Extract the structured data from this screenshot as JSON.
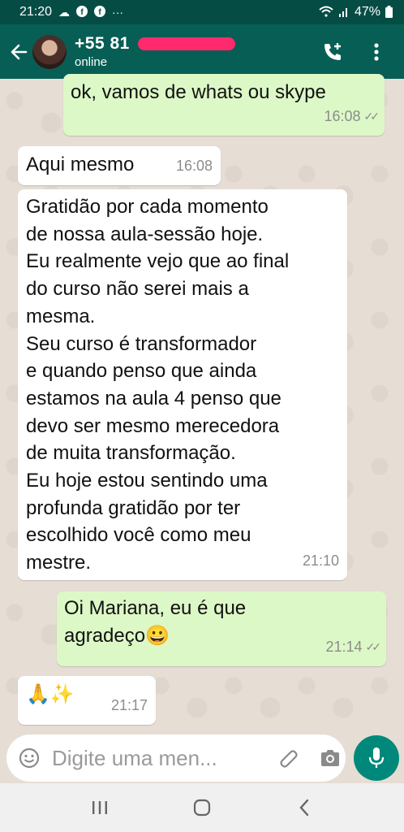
{
  "status_bar": {
    "time": "21:20",
    "notification_icons": [
      "cloud-icon",
      "facebook-icon",
      "facebook-icon",
      "more-dots-icon"
    ],
    "battery": "47%"
  },
  "header": {
    "contact_name": "+55 81",
    "status": "online"
  },
  "messages": [
    {
      "direction": "out",
      "text": "ok, vamos de whats ou skype",
      "time": "16:08",
      "read": true
    },
    {
      "direction": "in",
      "text": "Aqui mesmo",
      "time": "16:08"
    },
    {
      "direction": "in",
      "text": "Gratidão por cada momento\nde nossa aula-sessão hoje.\nEu realmente vejo que ao final\ndo curso não serei mais a\nmesma.\nSeu curso é transformador\ne quando penso que ainda\nestamos na aula 4 penso que\ndevo ser mesmo merecedora\nde muita transformação.\nEu hoje estou sentindo uma\nprofunda gratidão por ter\nescolhido você como meu\nmestre.",
      "time": "21:10"
    },
    {
      "direction": "out",
      "text": "Oi Mariana, eu é que\nagradeço😀",
      "time": "21:14",
      "read": true
    },
    {
      "direction": "in",
      "text": "🙏✨",
      "time": "21:17"
    }
  ],
  "composer": {
    "placeholder": "Digite uma men..."
  },
  "colors": {
    "header": "#075e54",
    "status_bar": "#054d44",
    "outgoing_bubble": "#dcf8c6",
    "incoming_bubble": "#ffffff",
    "chat_background": "#e6ddd4",
    "mic_button": "#00897b"
  }
}
